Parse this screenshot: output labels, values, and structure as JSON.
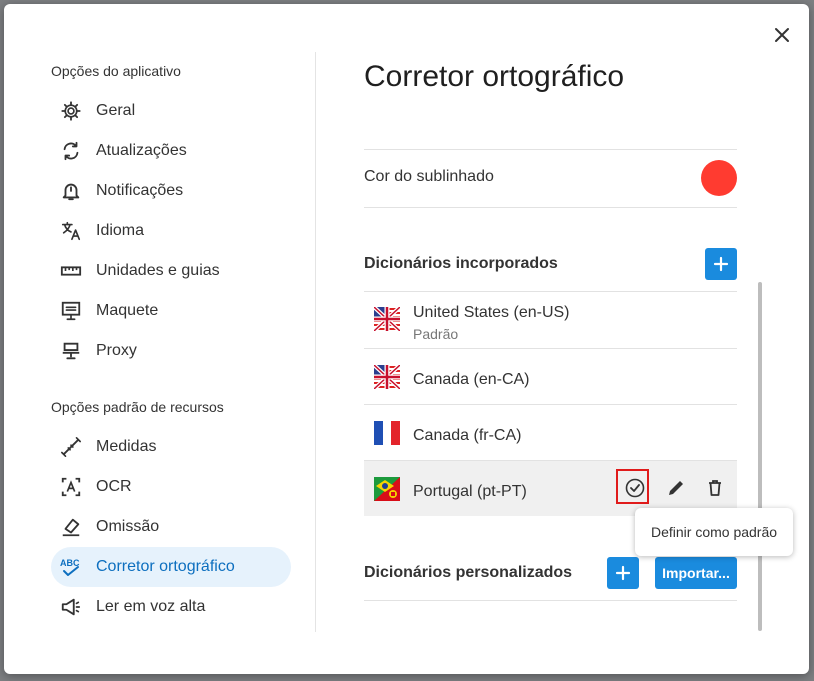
{
  "dialog": {
    "close_label": "×"
  },
  "sidebar": {
    "app_heading": "Opções do aplicativo",
    "app_items": [
      {
        "label": "Geral",
        "icon": "gear-icon"
      },
      {
        "label": "Atualizações",
        "icon": "refresh-icon"
      },
      {
        "label": "Notificações",
        "icon": "bell-icon"
      },
      {
        "label": "Idioma",
        "icon": "translate-icon"
      },
      {
        "label": "Unidades e guias",
        "icon": "ruler-icon"
      },
      {
        "label": "Maquete",
        "icon": "easel-icon"
      },
      {
        "label": "Proxy",
        "icon": "network-icon"
      }
    ],
    "feature_heading": "Opções padrão de recursos",
    "feature_items": [
      {
        "label": "Medidas",
        "icon": "measure-icon"
      },
      {
        "label": "OCR",
        "icon": "ocr-icon"
      },
      {
        "label": "Omissão",
        "icon": "eraser-icon"
      },
      {
        "label": "Corretor ortográfico",
        "icon": "abc-check-icon",
        "active": true
      },
      {
        "label": "Ler em voz alta",
        "icon": "megaphone-icon"
      }
    ]
  },
  "main": {
    "title": "Corretor ortográfico",
    "underline_color_label": "Cor do sublinhado",
    "underline_color": "#ff3b30",
    "builtin_title": "Dicionários incorporados",
    "builtin_add_label": "+",
    "dictionaries": [
      {
        "name": "United States (en-US)",
        "sub": "Padrão",
        "flag": "us-uk-flag"
      },
      {
        "name": "Canada (en-CA)",
        "flag": "us-uk-flag"
      },
      {
        "name": "Canada (fr-CA)",
        "flag": "france-flag"
      },
      {
        "name": "Portugal (pt-PT)",
        "flag": "brazil-portugal-flag"
      }
    ],
    "custom_title": "Dicionários personalizados",
    "custom_add_label": "+",
    "import_label": "Importar..."
  },
  "tooltip": {
    "text": "Definir como padrão"
  },
  "colors": {
    "accent": "#1a8bde",
    "active_bg": "#e6f2fc",
    "active_text": "#0d6fbf",
    "highlight": "#e01b1b"
  }
}
